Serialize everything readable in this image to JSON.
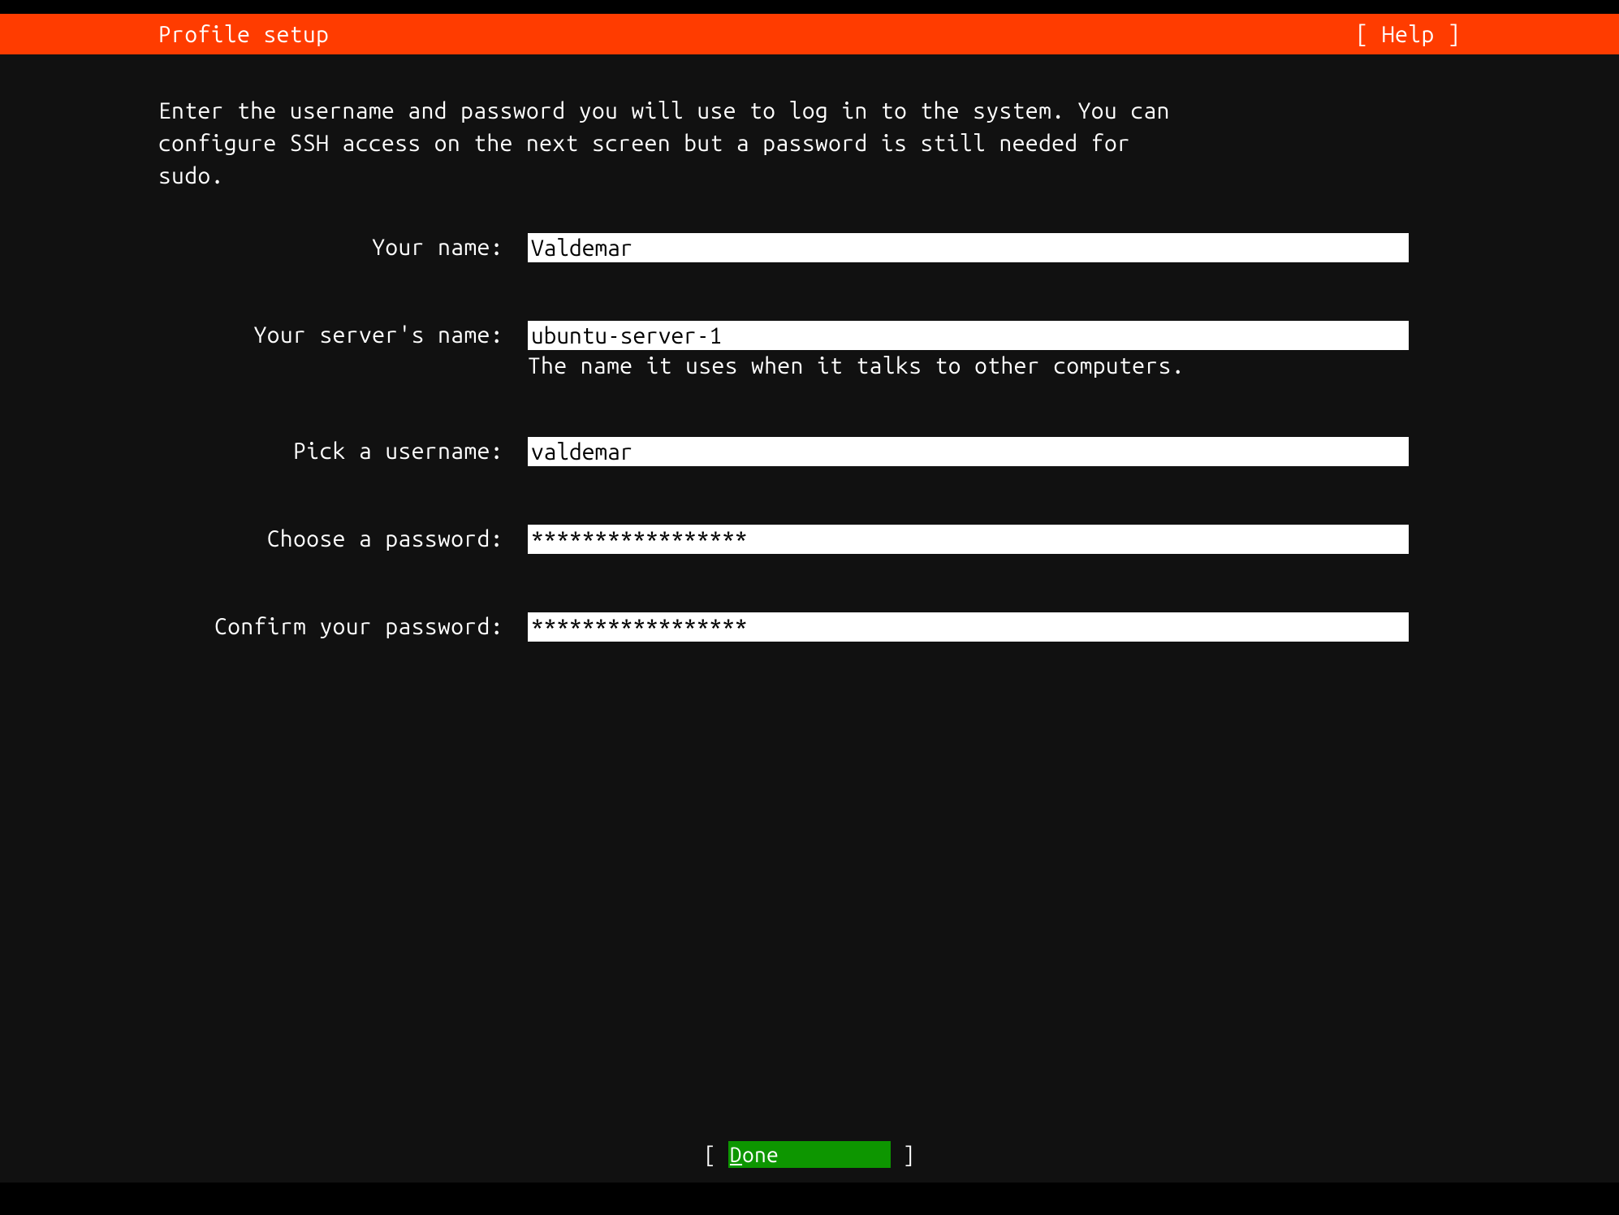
{
  "header": {
    "title": "Profile setup",
    "help": "[ Help ]"
  },
  "instruction": "Enter the username and password you will use to log in to the system. You can\nconfigure SSH access on the next screen but a password is still needed for\nsudo.",
  "fields": {
    "name": {
      "label": "Your name:",
      "value": "Valdemar"
    },
    "server": {
      "label": "Your server's name:",
      "value": "ubuntu-server-1",
      "hint": "The name it uses when it talks to other computers."
    },
    "username": {
      "label": "Pick a username:",
      "value": "valdemar"
    },
    "password": {
      "label": "Choose a password:",
      "value": "*****************"
    },
    "confirm": {
      "label": "Confirm your password:",
      "value": "*****************"
    }
  },
  "footer": {
    "done_first": "D",
    "done_rest": "one"
  }
}
